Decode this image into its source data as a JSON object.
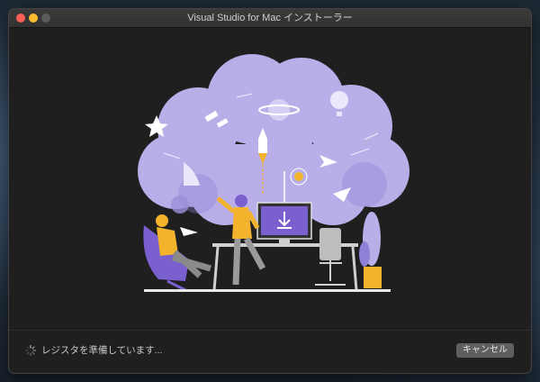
{
  "window": {
    "title": "Visual Studio for Mac インストーラー"
  },
  "status": {
    "text": "レジスタを準備しています..."
  },
  "buttons": {
    "cancel_label": "キャンセル"
  },
  "colors": {
    "cloud": "#b9aee8",
    "accent_purple": "#7a5fcf",
    "accent_yellow": "#f3b32c"
  }
}
